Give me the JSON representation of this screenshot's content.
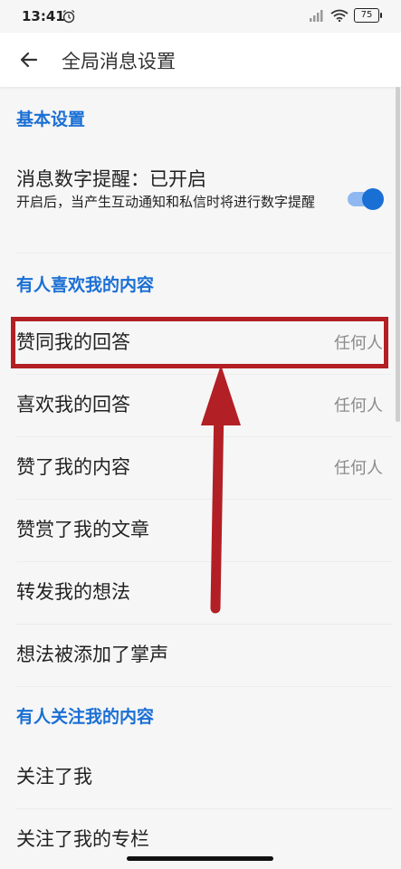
{
  "status_bar": {
    "time": "13:41",
    "alarm_icon": "alarm-clock-icon",
    "signal_icon": "cell-signal-icon",
    "wifi_icon": "wifi-icon",
    "battery": "75"
  },
  "app_bar": {
    "title": "全局消息设置",
    "back_icon": "arrow-left-icon"
  },
  "sections": {
    "basic": {
      "header": "基本设置",
      "setting_title": "消息数字提醒：已开启",
      "setting_desc": "开启后，当产生互动通知和私信时将进行数字提醒",
      "toggle_on": true,
      "accent": "#1a6fd4"
    },
    "likes": {
      "header": "有人喜欢我的内容",
      "items": [
        {
          "label": "赞同我的回答",
          "value": "任何人"
        },
        {
          "label": "喜欢我的回答",
          "value": "任何人"
        },
        {
          "label": "赞了我的内容",
          "value": "任何人"
        },
        {
          "label": "赞赏了我的文章",
          "value": ""
        },
        {
          "label": "转发我的想法",
          "value": ""
        },
        {
          "label": "想法被添加了掌声",
          "value": ""
        }
      ]
    },
    "follows": {
      "header": "有人关注我的内容",
      "items": [
        {
          "label": "关注了我"
        },
        {
          "label": "关注了我的专栏"
        }
      ]
    }
  },
  "annotation": {
    "highlight_color": "#b21f24"
  }
}
